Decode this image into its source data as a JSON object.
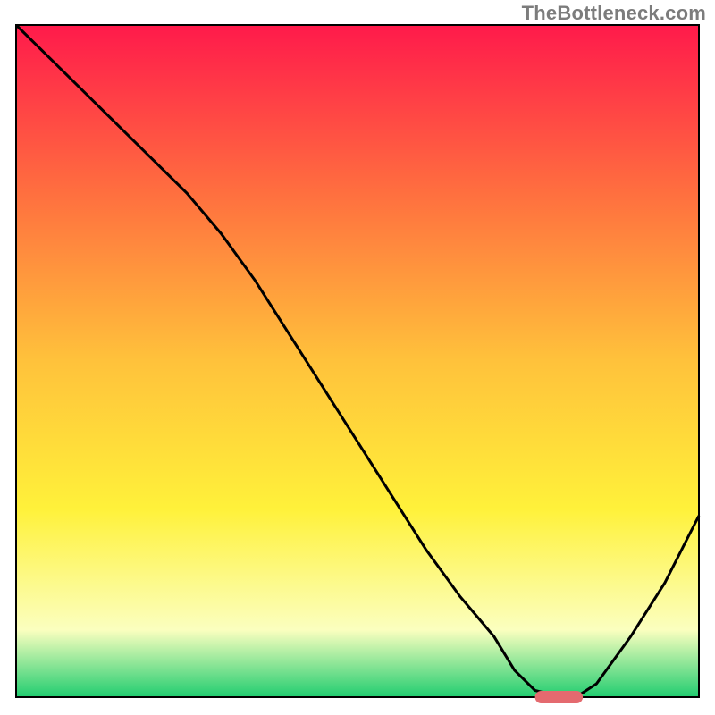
{
  "watermark": "TheBottleneck.com",
  "colors": {
    "gradient_top": "#ff1a4b",
    "gradient_mid_upper": "#ff6f3f",
    "gradient_mid": "#ffc23b",
    "gradient_mid_lower": "#fff13a",
    "gradient_low": "#fbffbf",
    "gradient_green": "#21cd70",
    "curve": "#000000",
    "marker": "#e46a6f",
    "frame": "#000000"
  },
  "chart_data": {
    "type": "line",
    "title": "",
    "xlabel": "",
    "ylabel": "",
    "xlim": [
      0,
      100
    ],
    "ylim": [
      0,
      100
    ],
    "grid": false,
    "legend": false,
    "series": [
      {
        "name": "bottleneck-curve",
        "x": [
          0,
          5,
          10,
          15,
          20,
          25,
          30,
          35,
          40,
          45,
          50,
          55,
          60,
          65,
          70,
          73,
          76,
          80,
          82,
          85,
          90,
          95,
          100
        ],
        "y": [
          100,
          95,
          90,
          85,
          80,
          75,
          69,
          62,
          54,
          46,
          38,
          30,
          22,
          15,
          9,
          4,
          1,
          0,
          0,
          2,
          9,
          17,
          27
        ]
      }
    ],
    "annotations": [
      {
        "name": "optimal-marker",
        "shape": "rounded-bar",
        "x_range": [
          76,
          83
        ],
        "y": 0,
        "color": "#e46a6f"
      }
    ],
    "background": {
      "type": "vertical-gradient",
      "stops": [
        {
          "pos": 0.0,
          "color": "#ff1a4b"
        },
        {
          "pos": 0.25,
          "color": "#ff6f3f"
        },
        {
          "pos": 0.5,
          "color": "#ffc23b"
        },
        {
          "pos": 0.72,
          "color": "#fff13a"
        },
        {
          "pos": 0.9,
          "color": "#fbffbf"
        },
        {
          "pos": 1.0,
          "color": "#21cd70"
        }
      ]
    }
  }
}
